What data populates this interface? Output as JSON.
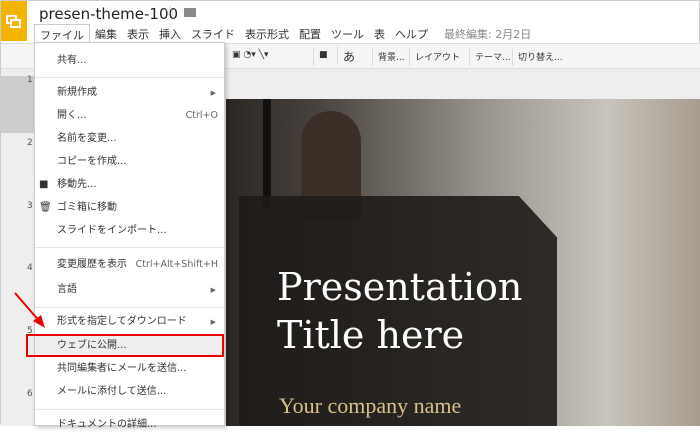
{
  "app": {
    "title": "presen-theme-100",
    "last_edit": "最終編集: 2月2日"
  },
  "menubar": [
    "ファイル",
    "編集",
    "表示",
    "挿入",
    "スライド",
    "表示形式",
    "配置",
    "ツール",
    "表",
    "ヘルプ"
  ],
  "toolbar": {
    "text": "あ",
    "background": "背景...",
    "layout": "レイアウト",
    "theme": "テーマ...",
    "transition": "切り替え..."
  },
  "slide_numbers": [
    "1",
    "2",
    "3",
    "4",
    "5",
    "6"
  ],
  "file_menu": [
    {
      "label": "共有..."
    },
    {
      "label": "新規作成",
      "submenu": true
    },
    {
      "label": "開く...",
      "shortcut": "Ctrl+O"
    },
    {
      "label": "名前を変更..."
    },
    {
      "label": "コピーを作成..."
    },
    {
      "label": "移動先...",
      "icon": "folder-icon"
    },
    {
      "label": "ゴミ箱に移動",
      "icon": "trash-icon"
    },
    {
      "label": "スライドをインポート..."
    },
    {
      "label": "変更履歴を表示",
      "shortcut": "Ctrl+Alt+Shift+H"
    },
    {
      "label": "言語",
      "submenu": true
    },
    {
      "label": "形式を指定してダウンロード",
      "submenu": true
    },
    {
      "label": "ウェブに公開..."
    },
    {
      "label": "共同編集者にメールを送信..."
    },
    {
      "label": "メールに添付して送信..."
    },
    {
      "label": "ドキュメントの詳細..."
    }
  ],
  "slide": {
    "title_line1": "Presentation",
    "title_line2": "Title here",
    "company": "Your company name"
  }
}
